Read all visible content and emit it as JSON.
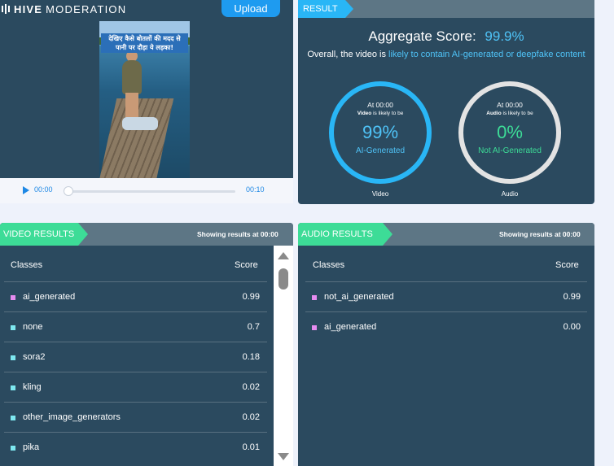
{
  "brand": {
    "name_bold": "HIVE",
    "name_rest": "MODERATION",
    "logo_icon": "hive-bars-icon"
  },
  "upload_label": "Upload",
  "video": {
    "caption_line1": "देखिए कैसे बोतलों की मदद से",
    "caption_line2": "पानी पर दौड़ा ये लड़का!",
    "current_time": "00:00",
    "duration": "00:10",
    "progress": 0.0
  },
  "result": {
    "tab_label": "RESULT",
    "aggregate_label": "Aggregate Score:",
    "aggregate_value": "99.9%",
    "overall_prefix": "Overall, the video is",
    "overall_highlight": "likely to contain AI-generated or deepfake content",
    "video_ring": {
      "at": "At 00:00",
      "subject": "Video",
      "likely": "is likely to be",
      "pct": "99%",
      "verdict": "AI-Generated",
      "caption": "Video",
      "color": "#29b6f6"
    },
    "audio_ring": {
      "at": "At 00:00",
      "subject": "Audio",
      "likely": "is likely to be",
      "pct": "0%",
      "verdict": "Not AI-Generated",
      "caption": "Audio",
      "color": "#3ddc97"
    }
  },
  "video_results": {
    "tab_label": "VIDEO RESULTS",
    "showing": "Showing results at 00:00",
    "col_classes": "Classes",
    "col_score": "Score",
    "rows": [
      {
        "cls": "ai_generated",
        "score": "0.99",
        "color": "#e58cf0"
      },
      {
        "cls": "none",
        "score": "0.7",
        "color": "#7ee8f0"
      },
      {
        "cls": "sora2",
        "score": "0.18",
        "color": "#7ee8f0"
      },
      {
        "cls": "kling",
        "score": "0.02",
        "color": "#7ee8f0"
      },
      {
        "cls": "other_image_generators",
        "score": "0.02",
        "color": "#7ee8f0"
      },
      {
        "cls": "pika",
        "score": "0.01",
        "color": "#7ee8f0"
      }
    ]
  },
  "audio_results": {
    "tab_label": "AUDIO RESULTS",
    "showing": "Showing results at 00:00",
    "col_classes": "Classes",
    "col_score": "Score",
    "rows": [
      {
        "cls": "not_ai_generated",
        "score": "0.99",
        "color": "#e58cf0"
      },
      {
        "cls": "ai_generated",
        "score": "0.00",
        "color": "#e58cf0"
      }
    ]
  }
}
